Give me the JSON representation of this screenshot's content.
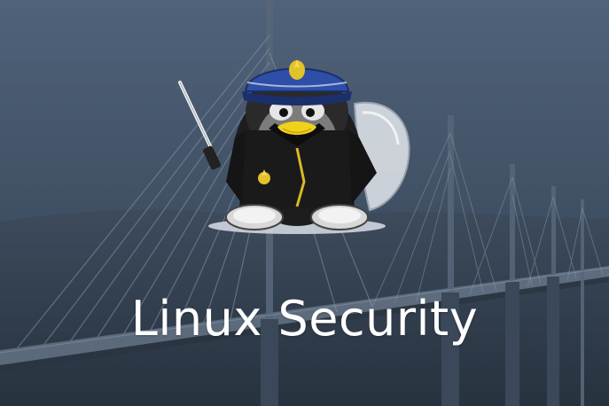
{
  "banner": {
    "headline": "Linux Security"
  },
  "mascot": {
    "icon": "tux-penguin-security-guard-icon",
    "props": [
      "police-cap-icon",
      "baton-icon",
      "riot-shield-icon",
      "gendarmerie-badge-icon"
    ]
  },
  "background": {
    "icon": "cable-stayed-bridge-icon"
  },
  "colors": {
    "sky_top": "#4e5f74",
    "sky_bottom": "#33414f",
    "text": "#ffffff",
    "cap_blue": "#2d4fa8",
    "badge_gold": "#e2c22a",
    "beak_yellow": "#f0d21a"
  }
}
